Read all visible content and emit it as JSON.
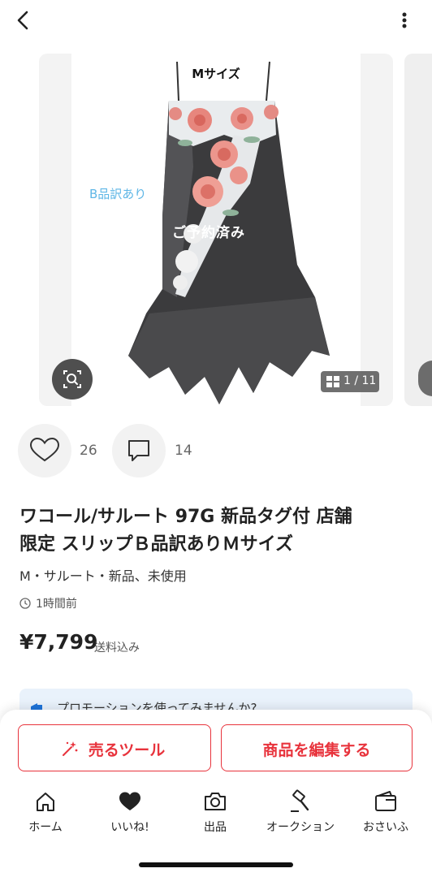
{
  "header": {
    "back_icon": "chevron-left-icon",
    "more_icon": "vertical-dots-icon"
  },
  "gallery": {
    "overlay_size": "Mサイズ",
    "overlay_condition": "B品訳あり",
    "overlay_reserved": "ご予約済み",
    "counter": "1 / 11"
  },
  "actions": {
    "likes": "26",
    "comments": "14"
  },
  "item": {
    "title_line1": "ワコール/サルート 97G 新品タグ付 店舗",
    "title_line2": "限定 スリップＢ品訳ありＭサイズ",
    "subtitle": "M・サルート・新品、未使用",
    "time": "1時間前",
    "price": "¥7,799",
    "shipping": "送料込み"
  },
  "promo": {
    "text": "プロモーションを使ってみませんか?"
  },
  "buttons": {
    "sell_tool": "売るツール",
    "edit_item": "商品を編集する"
  },
  "tabs": [
    {
      "label": "ホーム",
      "icon": "home-icon"
    },
    {
      "label": "いいね!",
      "icon": "heart-icon"
    },
    {
      "label": "出品",
      "icon": "camera-icon"
    },
    {
      "label": "オークション",
      "icon": "gavel-icon"
    },
    {
      "label": "おさいふ",
      "icon": "wallet-icon"
    }
  ],
  "colors": {
    "accent": "#e8333c",
    "promo_bg": "#e9f2fb",
    "condition_text": "#5eb6e6"
  }
}
